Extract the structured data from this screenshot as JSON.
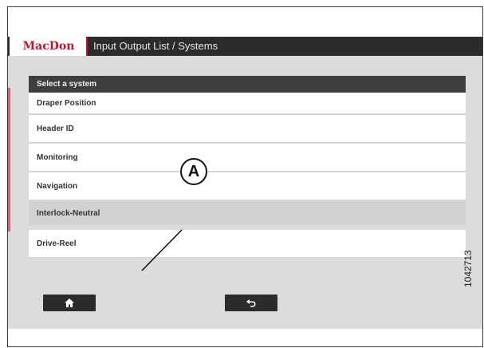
{
  "header": {
    "logo_text": "MacDon",
    "title": "Input Output List / Systems"
  },
  "panel": {
    "title": "Select a system",
    "items": [
      {
        "label": "Draper Position"
      },
      {
        "label": "Header ID"
      },
      {
        "label": "Monitoring"
      },
      {
        "label": "Navigation"
      },
      {
        "label": "Interlock-Neutral",
        "selected": true
      },
      {
        "label": "Drive-Reel"
      }
    ]
  },
  "footer": {
    "home_icon": "home-icon",
    "back_icon": "back-arrow-icon"
  },
  "annotation": {
    "callout_label": "A",
    "figure_number": "1042713"
  },
  "colors": {
    "brand_red": "#c8102e",
    "titlebar": "#2b2b2b",
    "screen_bg": "#dcdcdc",
    "selected_row": "#d2d2d2"
  }
}
